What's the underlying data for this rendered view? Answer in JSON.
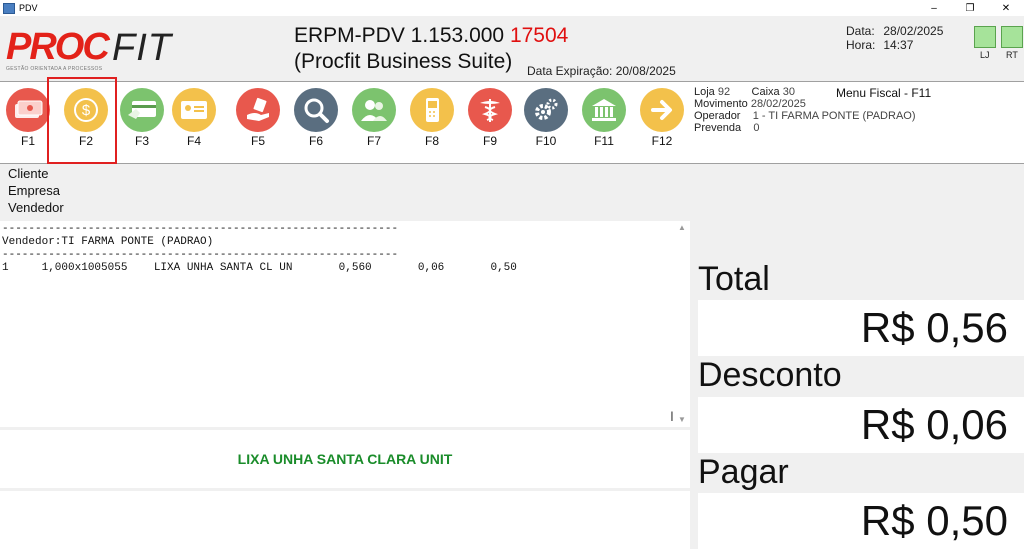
{
  "window": {
    "title": "PDV",
    "controls": [
      "–",
      "❐",
      "✕"
    ]
  },
  "logo": {
    "text_red": "PROC",
    "text_dark": "FIT",
    "slogan": "GESTÃO ORIENTADA A PROCESSOS"
  },
  "header": {
    "title": "ERPM-PDV 1.153.000",
    "build": "17504",
    "subtitle": "(Procfit Business Suite)",
    "expiry": "Data Expiração: 20/08/2025",
    "date_label": "Data:",
    "date_value": "28/02/2025",
    "time_label": "Hora:",
    "time_value": "14:37",
    "indicators": [
      "LJ",
      "RT"
    ]
  },
  "toolbar": {
    "buttons": [
      {
        "label": "F1",
        "icon": "cash-money-icon",
        "color": "#e8584d"
      },
      {
        "label": "F2",
        "icon": "dollar-coin-icon",
        "color": "#f3c14b"
      },
      {
        "label": "F3",
        "icon": "card-payment-icon",
        "color": "#7cc36e"
      },
      {
        "label": "F4",
        "icon": "id-card-icon",
        "color": "#f3c14b"
      },
      {
        "label": "F5",
        "icon": "hand-pay-icon",
        "color": "#e8584d"
      },
      {
        "label": "F6",
        "icon": "search-icon",
        "color": "#5a6e80"
      },
      {
        "label": "F7",
        "icon": "users-icon",
        "color": "#7cc36e"
      },
      {
        "label": "F8",
        "icon": "mobile-phone-icon",
        "color": "#f3c14b"
      },
      {
        "label": "F9",
        "icon": "caduceus-icon",
        "color": "#e8584d"
      },
      {
        "label": "F10",
        "icon": "gears-icon",
        "color": "#5a6e80"
      },
      {
        "label": "F11",
        "icon": "bank-icon",
        "color": "#7cc36e"
      },
      {
        "label": "F12",
        "icon": "arrow-right-icon",
        "color": "#f3c14b"
      }
    ]
  },
  "session": {
    "loja_label": "Loja",
    "loja": "92",
    "caixa_label": "Caixa",
    "caixa": "30",
    "movimento_label": "Movimento",
    "movimento": "28/02/2025",
    "operador_label": "Operador",
    "operador": "1 - TI FARMA PONTE (PADRAO)",
    "prevenda_label": "Prevenda",
    "prevenda": "0",
    "menu_fiscal": "Menu Fiscal - F11"
  },
  "customer": {
    "cliente": "Cliente",
    "empresa": "Empresa",
    "vendedor": "Vendedor"
  },
  "receipt": {
    "separator": "------------------------------------------------------------",
    "vendedor_line": "Vendedor:TI FARMA PONTE (PADRAO)",
    "items": [
      "1     1,000x1005055    LIXA UNHA SANTA CL UN       0,560       0,06       0,50"
    ]
  },
  "product_display": "LIXA UNHA SANTA CLARA UNIT",
  "totals": {
    "total_label": "Total",
    "total_value": "R$ 0,56",
    "desconto_label": "Desconto",
    "desconto_value": "R$ 0,06",
    "pagar_label": "Pagar",
    "pagar_value": "R$ 0,50"
  }
}
